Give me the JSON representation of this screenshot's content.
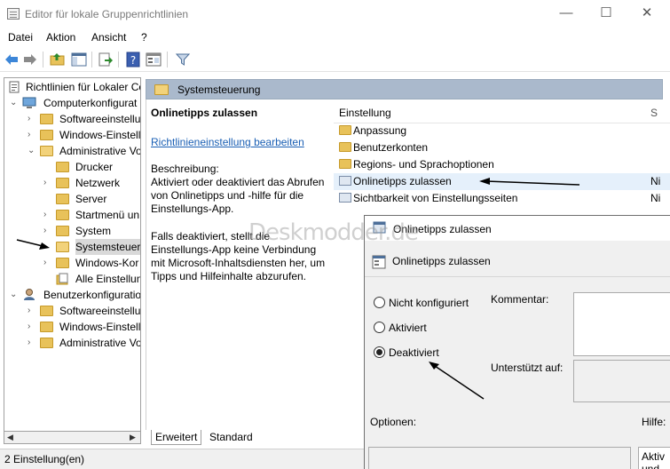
{
  "window": {
    "title": "Editor für lokale Gruppenrichtlinien",
    "controls": [
      "—",
      "☐",
      "✕"
    ]
  },
  "menu": [
    "Datei",
    "Aktion",
    "Ansicht",
    "?"
  ],
  "toolbar": {
    "icons": [
      "back-icon",
      "forward-icon",
      "up-folder-icon",
      "show-hide-tree-icon",
      "export-list-icon",
      "help-icon",
      "properties-icon",
      "filter-icon"
    ]
  },
  "tree": {
    "items": [
      {
        "label": "Richtlinien für Lokaler Co",
        "icon": "policy-doc-icon",
        "chev": ""
      },
      {
        "label": "Computerkonfigurat",
        "icon": "computer-icon",
        "chev": "⌄"
      },
      {
        "label": "Softwareeinstellu",
        "icon": "folder-icon",
        "chev": "›"
      },
      {
        "label": "Windows-Einstell",
        "icon": "folder-icon",
        "chev": "›"
      },
      {
        "label": "Administrative Vo",
        "icon": "folder-icon",
        "chev": "⌄"
      },
      {
        "label": "Drucker",
        "icon": "folder-icon",
        "chev": ""
      },
      {
        "label": "Netzwerk",
        "icon": "folder-icon",
        "chev": "›"
      },
      {
        "label": "Server",
        "icon": "folder-icon",
        "chev": ""
      },
      {
        "label": "Startmenü un",
        "icon": "folder-icon",
        "chev": "›"
      },
      {
        "label": "System",
        "icon": "folder-icon",
        "chev": "›"
      },
      {
        "label": "Systemsteuer",
        "icon": "folder-icon",
        "chev": "›"
      },
      {
        "label": "Windows-Kor",
        "icon": "folder-icon",
        "chev": "›"
      },
      {
        "label": "Alle Einstellun",
        "icon": "all-settings-icon",
        "chev": ""
      },
      {
        "label": "Benutzerkonfiguratio",
        "icon": "user-icon",
        "chev": "⌄"
      },
      {
        "label": "Softwareeinstellu",
        "icon": "folder-icon",
        "chev": "›"
      },
      {
        "label": "Windows-Einstell",
        "icon": "folder-icon",
        "chev": "›"
      },
      {
        "label": "Administrative Vo",
        "icon": "folder-icon",
        "chev": "›"
      }
    ]
  },
  "middle": {
    "header": "Systemsteuerung",
    "policy_title": "Onlinetipps zulassen",
    "edit_link": "Richtlinieneinstellung bearbeiten",
    "description_label": "Beschreibung:",
    "description_text": "Aktiviert oder deaktiviert das Abrufen von Onlinetipps und -hilfe für die Einstellungs-App.",
    "description_text2": "Falls deaktiviert, stellt die Einstellungs-App keine Verbindung mit Microsoft-Inhaltsdiensten her, um Tipps und Hilfeinhalte abzurufen."
  },
  "list": {
    "column_setting": "Einstellung",
    "column_state": "S",
    "rows": [
      {
        "label": "Anpassung",
        "icon": "folder-icon",
        "state": ""
      },
      {
        "label": "Benutzerkonten",
        "icon": "folder-icon",
        "state": ""
      },
      {
        "label": "Regions- und Sprachoptionen",
        "icon": "folder-icon",
        "state": ""
      },
      {
        "label": "Onlinetipps zulassen",
        "icon": "setting-icon",
        "state": "Ni"
      },
      {
        "label": "Sichtbarkeit von Einstellungsseiten",
        "icon": "setting-icon",
        "state": "Ni"
      }
    ]
  },
  "tabs": [
    "Erweitert",
    "Standard"
  ],
  "status": "2 Einstellung(en)",
  "watermark": "Deskmodder.de",
  "dialog": {
    "title": "Onlinetipps zulassen",
    "subheader": "Onlinetipps zulassen",
    "options": [
      "Nicht konfiguriert",
      "Aktiviert",
      "Deaktiviert"
    ],
    "selected_option": "Deaktiviert",
    "comment_label": "Kommentar:",
    "supported_label": "Unterstützt auf:",
    "options_label": "Optionen:",
    "help_label": "Hilfe:",
    "help_box_text": "Aktiv\nund -"
  }
}
